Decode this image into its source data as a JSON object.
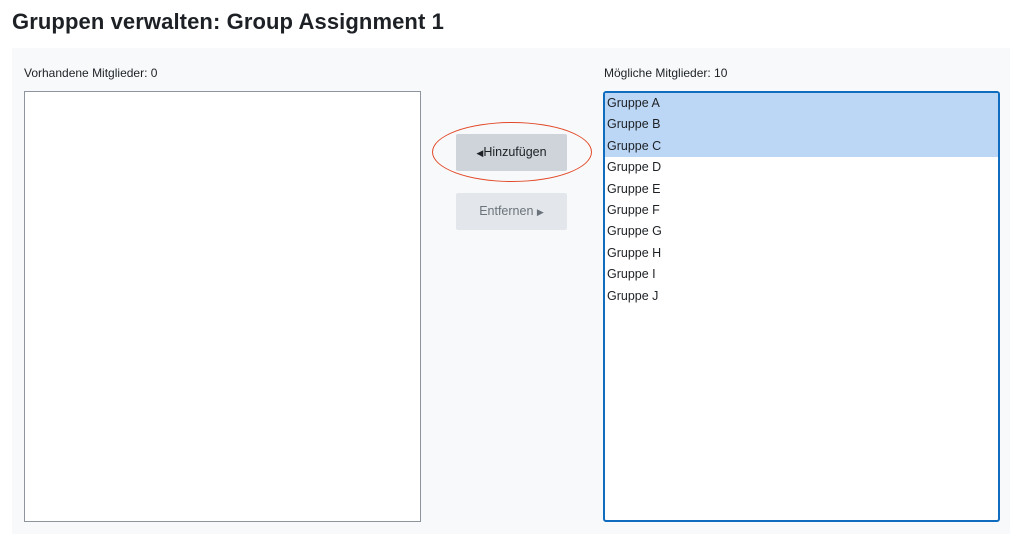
{
  "page": {
    "title": "Gruppen verwalten: Group Assignment 1"
  },
  "existing_members": {
    "label": "Vorhandene Mitglieder: 0",
    "items": []
  },
  "potential_members": {
    "label": "Mögliche Mitglieder: 10",
    "items": [
      {
        "label": "Gruppe A",
        "selected": true
      },
      {
        "label": "Gruppe B",
        "selected": true
      },
      {
        "label": "Gruppe C",
        "selected": true
      },
      {
        "label": "Gruppe D",
        "selected": false
      },
      {
        "label": "Gruppe E",
        "selected": false
      },
      {
        "label": "Gruppe F",
        "selected": false
      },
      {
        "label": "Gruppe G",
        "selected": false
      },
      {
        "label": "Gruppe H",
        "selected": false
      },
      {
        "label": "Gruppe I",
        "selected": false
      },
      {
        "label": "Gruppe J",
        "selected": false
      }
    ]
  },
  "actions": {
    "add_label": "Hinzufügen",
    "add_arrow": "◀",
    "remove_label": "Entfernen",
    "remove_arrow": "▶"
  },
  "colors": {
    "selected_bg": "#bcd7f6",
    "focus_border": "#0f6cbf",
    "annotation": "#e24a2a"
  }
}
